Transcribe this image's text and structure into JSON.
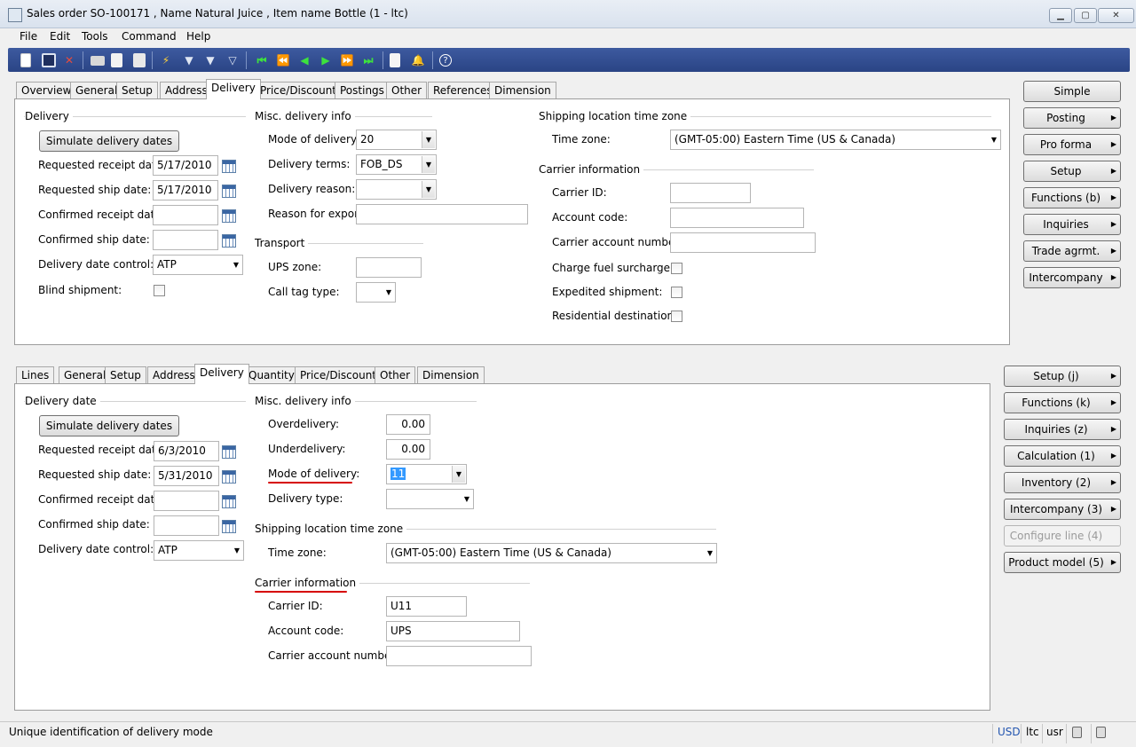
{
  "window": {
    "title": "Sales order SO-100171 , Name Natural Juice , Item name Bottle (1 - ltc)",
    "minimize": "▁",
    "maximize": "▢",
    "close": "✕"
  },
  "menu": [
    "File",
    "Edit",
    "Tools",
    "Command",
    "Help"
  ],
  "toolbar_icons": [
    "new-icon",
    "save-icon",
    "delete-icon",
    "print-icon",
    "print-preview-icon",
    "export-icon",
    "filter-by-selection-icon",
    "filter-icon",
    "advanced-filter-icon",
    "remove-filter-icon",
    "first-record-icon",
    "previous-page-icon",
    "previous-record-icon",
    "next-record-icon",
    "next-page-icon",
    "last-record-icon",
    "attachment-icon",
    "alert-icon",
    "help-icon"
  ],
  "header": {
    "tabs": [
      "Overview",
      "General",
      "Setup",
      "Address",
      "Delivery",
      "Price/Discount",
      "Postings",
      "Other",
      "References",
      "Dimension"
    ],
    "active_tab": "Delivery",
    "delivery": {
      "group": "Delivery",
      "simulate_button": "Simulate delivery dates",
      "requested_receipt_label": "Requested receipt date:",
      "requested_receipt_value": "5/17/2010",
      "requested_ship_label": "Requested ship date:",
      "requested_ship_value": "5/17/2010",
      "confirmed_receipt_label": "Confirmed receipt date:",
      "confirmed_receipt_value": "",
      "confirmed_ship_label": "Confirmed ship date:",
      "confirmed_ship_value": "",
      "date_control_label": "Delivery date control:",
      "date_control_value": "ATP",
      "blind_shipment_label": "Blind shipment:"
    },
    "misc": {
      "group": "Misc. delivery info",
      "mode_label": "Mode of delivery:",
      "mode_value": "20",
      "terms_label": "Delivery terms:",
      "terms_value": "FOB_DS",
      "reason_label": "Delivery reason:",
      "reason_value": "",
      "export_label": "Reason for export:",
      "export_value": ""
    },
    "transport": {
      "group": "Transport",
      "ups_label": "UPS zone:",
      "ups_value": "",
      "calltag_label": "Call tag type:",
      "calltag_value": ""
    },
    "shipping": {
      "group": "Shipping location time zone",
      "tz_label": "Time zone:",
      "tz_value": "(GMT-05:00) Eastern Time (US & Canada)"
    },
    "carrier": {
      "group": "Carrier information",
      "id_label": "Carrier ID:",
      "id_value": "",
      "account_label": "Account code:",
      "account_value": "",
      "carrier_account_label": "Carrier account number:",
      "carrier_account_value": "",
      "fuel_label": "Charge fuel surcharge:",
      "expedited_label": "Expedited shipment:",
      "residential_label": "Residential destination:"
    },
    "buttons": [
      {
        "label": "Simple",
        "arrow": false
      },
      {
        "label": "Posting",
        "arrow": true
      },
      {
        "label": "Pro forma",
        "arrow": true
      },
      {
        "label": "Setup",
        "arrow": true
      },
      {
        "label": "Functions (b)",
        "arrow": true
      },
      {
        "label": "Inquiries",
        "arrow": true
      },
      {
        "label": "Trade agrmt.",
        "arrow": true
      },
      {
        "label": "Intercompany",
        "arrow": true
      }
    ]
  },
  "lines": {
    "tabs": [
      "Lines",
      "General",
      "Setup",
      "Address",
      "Delivery",
      "Quantity",
      "Price/Discount",
      "Other",
      "Dimension"
    ],
    "active_tab": "Delivery",
    "delivery": {
      "group": "Delivery date",
      "simulate_button": "Simulate delivery dates",
      "requested_receipt_label": "Requested receipt date:",
      "requested_receipt_value": "6/3/2010",
      "requested_ship_label": "Requested ship date:",
      "requested_ship_value": "5/31/2010",
      "confirmed_receipt_label": "Confirmed receipt date:",
      "confirmed_receipt_value": "",
      "confirmed_ship_label": "Confirmed ship date:",
      "confirmed_ship_value": "",
      "date_control_label": "Delivery date control:",
      "date_control_value": "ATP"
    },
    "misc": {
      "group": "Misc. delivery info",
      "over_label": "Overdelivery:",
      "over_value": "0.00",
      "under_label": "Underdelivery:",
      "under_value": "0.00",
      "mode_label": "Mode of delivery:",
      "mode_value": "11",
      "type_label": "Delivery type:",
      "type_value": ""
    },
    "shipping": {
      "group": "Shipping location time zone",
      "tz_label": "Time zone:",
      "tz_value": "(GMT-05:00) Eastern Time (US & Canada)"
    },
    "carrier": {
      "group": "Carrier information",
      "id_label": "Carrier ID:",
      "id_value": "U11",
      "account_label": "Account code:",
      "account_value": "UPS",
      "carrier_account_label": "Carrier account number:",
      "carrier_account_value": ""
    },
    "buttons": [
      {
        "label": "Setup (j)",
        "disabled": false
      },
      {
        "label": "Functions (k)",
        "disabled": false
      },
      {
        "label": "Inquiries (z)",
        "disabled": false
      },
      {
        "label": "Calculation (1)",
        "disabled": false
      },
      {
        "label": "Inventory (2)",
        "disabled": false
      },
      {
        "label": "Intercompany (3)",
        "disabled": false
      },
      {
        "label": "Configure line (4)",
        "disabled": true
      },
      {
        "label": "Product model (5)",
        "disabled": false
      }
    ]
  },
  "status": {
    "text": "Unique identification of delivery mode",
    "currency": "USD",
    "company": "ltc",
    "layer": "usr"
  },
  "colors": {
    "toolbar": "#2f4c8f",
    "highlight": "#d60000",
    "selection": "#3399ff"
  }
}
